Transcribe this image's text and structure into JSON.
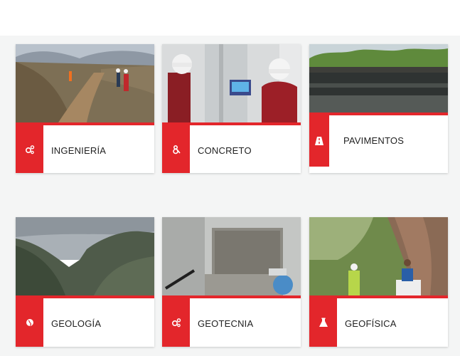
{
  "colors": {
    "accent": "#e3262b",
    "background": "#f4f5f5",
    "card": "#ffffff",
    "text": "#222222"
  },
  "cards": [
    {
      "label": "INGENIERÍA",
      "icon": "cogs-icon"
    },
    {
      "label": "CONCRETO",
      "icon": "ampersand-icon"
    },
    {
      "label": "PAVIMENTOS",
      "icon": "road-icon"
    },
    {
      "label": "GEOLOGÍA",
      "icon": "globe-icon"
    },
    {
      "label": "GEOTECNIA",
      "icon": "cogs-icon"
    },
    {
      "label": "GEOFÍSICA",
      "icon": "flask-icon"
    }
  ]
}
